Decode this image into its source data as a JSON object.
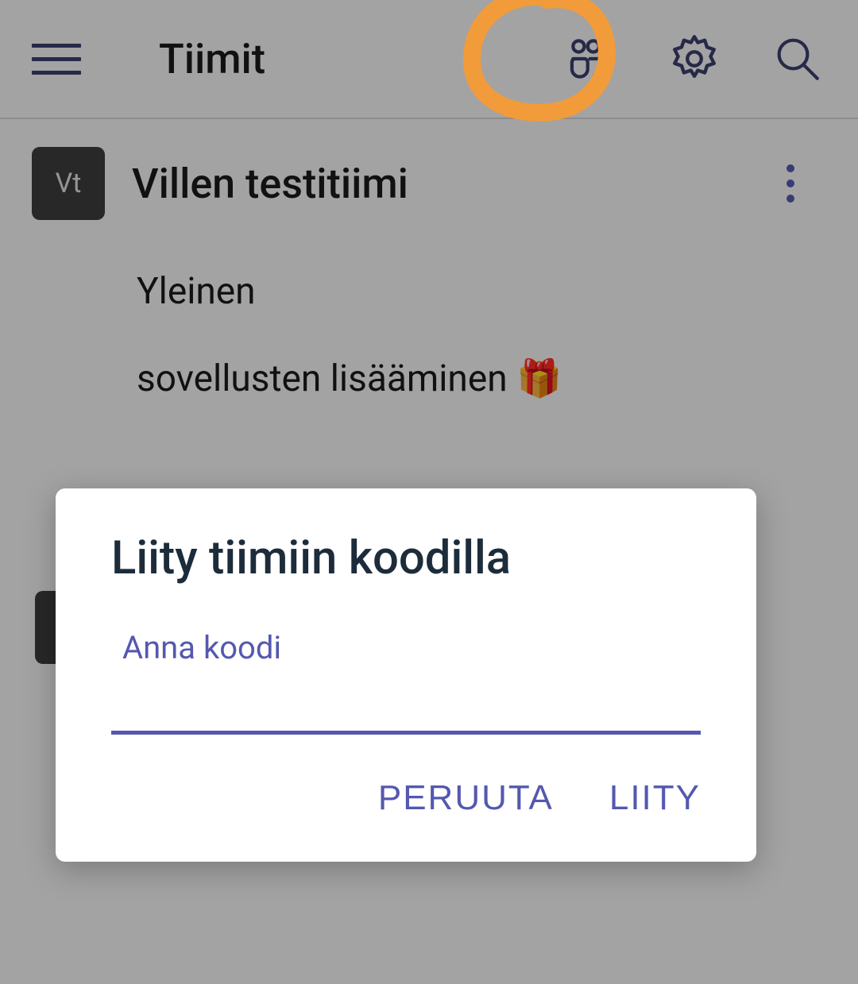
{
  "header": {
    "title": "Tiimit"
  },
  "team": {
    "avatar_text": "Vt",
    "name": "Villen testitiimi",
    "channels": [
      {
        "label": "Yleinen"
      },
      {
        "label": "sovellusten lisääminen 🎁"
      }
    ]
  },
  "dialog": {
    "title": "Liity tiimiin koodilla",
    "input_label": "Anna koodi",
    "input_value": "",
    "cancel": "PERUUTA",
    "join": "LIITY"
  },
  "colors": {
    "accent": "#5558af",
    "highlight": "#f29b3a"
  }
}
